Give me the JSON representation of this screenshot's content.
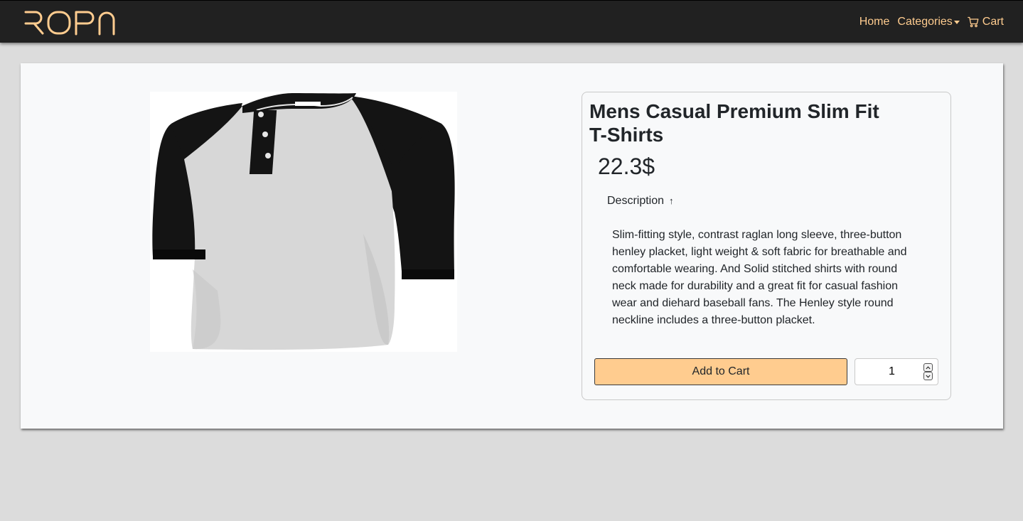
{
  "brand": {
    "logo_text": "ROPN"
  },
  "nav": {
    "home_label": "Home",
    "categories_label": "Categories",
    "cart_label": "Cart"
  },
  "icons": {
    "cart": "cart-icon",
    "caret": "caret-down-icon",
    "description_toggle": "arrow-up-icon",
    "stepper_up": "chevron-up-icon",
    "stepper_down": "chevron-down-icon"
  },
  "product": {
    "title": "Mens Casual Premium Slim Fit T-Shirts",
    "price": "22.3$",
    "image_alt": "Black and grey raglan henley t-shirt",
    "description_label": "Description",
    "description_arrow": "↑",
    "description": "Slim-fitting style, contrast raglan long sleeve, three-button henley placket, light weight & soft fabric for breathable and comfortable wearing. And Solid stitched shirts with round neck made for durability and a great fit for casual fashion wear and diehard baseball fans. The Henley style round neckline includes a three-button placket."
  },
  "actions": {
    "add_to_cart_label": "Add to Cart",
    "quantity_value": "1"
  },
  "colors": {
    "navbar_bg": "#212121",
    "accent": "#ffcc8f",
    "page_bg": "#dcdcdc",
    "card_bg": "#f8f9fa"
  }
}
